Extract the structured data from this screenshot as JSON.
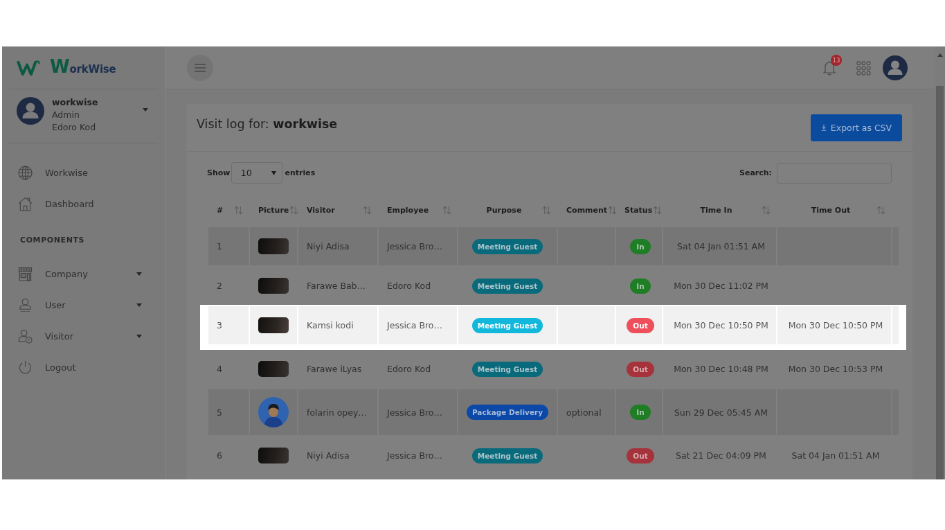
{
  "sidebar": {
    "logo": "WorkWise",
    "user": {
      "name": "workwise",
      "role": "Admin",
      "company": "Edoro Kod",
      "expanded": false
    },
    "items": [
      {
        "label": "Workwise",
        "kind": "link"
      },
      {
        "label": "Dashboard",
        "kind": "link"
      }
    ],
    "section_label": "COMPONENTS",
    "components": [
      {
        "label": "Company",
        "kind": "dropdown",
        "expanded": false
      },
      {
        "label": "User",
        "kind": "dropdown",
        "expanded": false
      },
      {
        "label": "Visitor",
        "kind": "dropdown",
        "expanded": false
      },
      {
        "label": "Logout",
        "kind": "link"
      }
    ]
  },
  "topbar": {
    "notifications": "13"
  },
  "card": {
    "title": "Visit log for: **workwise**",
    "export_button": "Export as CSV"
  },
  "table_controls": {
    "show_label": "Show",
    "page_size": "10",
    "entries_label": "entries",
    "search_label": "Search:"
  },
  "table": {
    "columns": [
      "#",
      "Picture",
      "Visitor",
      "Employee",
      "Purpose",
      "Comment",
      "Status",
      "Time In",
      "Time Out"
    ],
    "rows": [
      {
        "highlighted": false,
        "number": "1",
        "picture": {
          "kind": "photo"
        },
        "visitor": "Niyi Adisa",
        "employee": "Jessica Bro…",
        "purpose": {
          "label": "Meeting Guest",
          "kind": "meeting"
        },
        "status": {
          "label": "In",
          "kind": "in"
        },
        "time_in": "Sat 04 Jan 01:51 AM"
      },
      {
        "highlighted": false,
        "number": "2",
        "picture": {
          "kind": "photo"
        },
        "visitor": "Farawe Bab…",
        "employee": "Edoro Kod",
        "purpose": {
          "label": "Meeting Guest",
          "kind": "meeting"
        },
        "status": {
          "label": "In",
          "kind": "in"
        },
        "time_in": "Mon 30 Dec 11:02 PM"
      },
      {
        "highlighted": true,
        "number": "3",
        "picture": {
          "kind": "photo"
        },
        "visitor": "Kamsi kodi",
        "employee": "Jessica Bro…",
        "purpose": {
          "label": "Meeting Guest",
          "kind": "meeting"
        },
        "status": {
          "label": "Out",
          "kind": "out"
        },
        "time_in": "Mon 30 Dec 10:50 PM",
        "time_out": "Mon 30 Dec 10:50 PM"
      },
      {
        "highlighted": false,
        "number": "4",
        "picture": {
          "kind": "photo"
        },
        "visitor": "Farawe iLyas",
        "employee": "Edoro Kod",
        "purpose": {
          "label": "Meeting Guest",
          "kind": "meeting"
        },
        "status": {
          "label": "Out",
          "kind": "out"
        },
        "time_in": "Mon 30 Dec 10:48 PM",
        "time_out": "Mon 30 Dec 10:53 PM"
      },
      {
        "highlighted": false,
        "number": "5",
        "picture": {
          "kind": "avatar"
        },
        "visitor": "folarin opey…",
        "employee": "Jessica Bro…",
        "purpose": {
          "label": "Package Delivery",
          "kind": "delivery"
        },
        "comment": "optional",
        "status": {
          "label": "In",
          "kind": "in"
        },
        "time_in": "Sun 29 Dec 05:45 AM"
      },
      {
        "highlighted": false,
        "number": "6",
        "picture": {
          "kind": "photo"
        },
        "visitor": "Niyi Adisa",
        "employee": "Jessica Bro…",
        "purpose": {
          "label": "Meeting Guest",
          "kind": "meeting"
        },
        "status": {
          "label": "Out",
          "kind": "out"
        },
        "time_in": "Sat 21 Dec 04:09 PM",
        "time_out": "Sat 04 Jan 01:51 AM"
      }
    ]
  }
}
